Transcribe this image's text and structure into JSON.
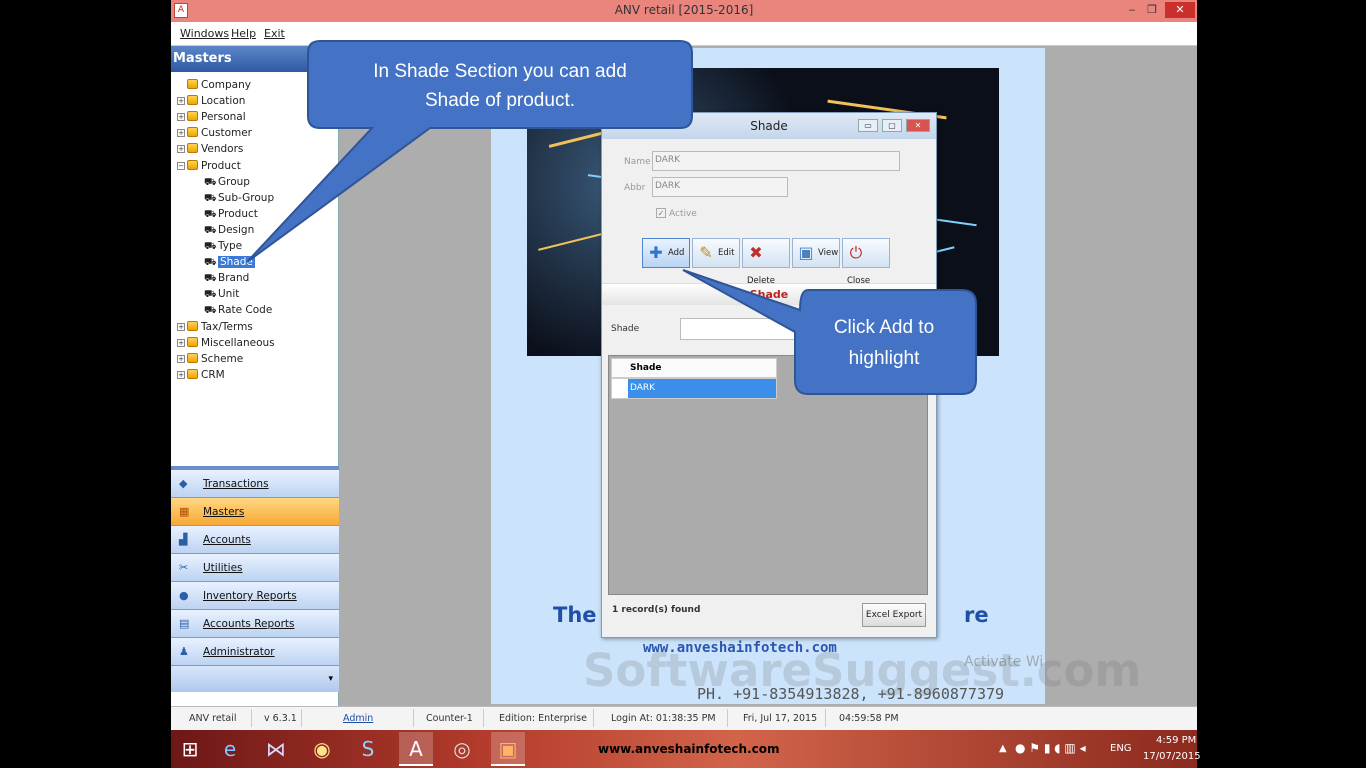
{
  "window": {
    "title": "ANV retail [2015-2016]",
    "icon": "anv-logo-icon",
    "min": "‒",
    "max": "❐",
    "close": "✕"
  },
  "menu": [
    "Windows",
    "Help",
    "Exit"
  ],
  "sidebar": {
    "header": "Masters",
    "tree": [
      {
        "label": "Company",
        "level": 0,
        "expander": ""
      },
      {
        "label": "Location",
        "level": 0,
        "expander": "+"
      },
      {
        "label": "Personal",
        "level": 0,
        "expander": "+"
      },
      {
        "label": "Customer",
        "level": 0,
        "expander": "+"
      },
      {
        "label": "Vendors",
        "level": 0,
        "expander": "+"
      },
      {
        "label": "Product",
        "level": 0,
        "expander": "−"
      },
      {
        "label": "Group",
        "level": 1
      },
      {
        "label": "Sub-Group",
        "level": 1
      },
      {
        "label": "Product",
        "level": 1
      },
      {
        "label": "Design",
        "level": 1
      },
      {
        "label": "Type",
        "level": 1
      },
      {
        "label": "Shade",
        "level": 1,
        "selected": true
      },
      {
        "label": "Brand",
        "level": 1
      },
      {
        "label": "Unit",
        "level": 1
      },
      {
        "label": "Rate Code",
        "level": 1
      },
      {
        "label": "Tax/Terms",
        "level": 0,
        "expander": "+"
      },
      {
        "label": "Miscellaneous",
        "level": 0,
        "expander": "+"
      },
      {
        "label": "Scheme",
        "level": 0,
        "expander": "+"
      },
      {
        "label": "CRM",
        "level": 0,
        "expander": "+"
      }
    ],
    "nav": [
      {
        "label": "Transactions",
        "icon": "transactions-icon",
        "glyph": "◆"
      },
      {
        "label": "Masters",
        "icon": "masters-icon",
        "glyph": "▦",
        "active": true
      },
      {
        "label": "Accounts",
        "icon": "accounts-icon",
        "glyph": "▟"
      },
      {
        "label": "Utilities",
        "icon": "utilities-icon",
        "glyph": "✂"
      },
      {
        "label": "Inventory Reports",
        "icon": "inventory-reports-icon",
        "glyph": "●"
      },
      {
        "label": "Accounts Reports",
        "icon": "accounts-reports-icon",
        "glyph": "▤"
      },
      {
        "label": "Administrator",
        "icon": "administrator-icon",
        "glyph": "♟"
      }
    ],
    "more": "▾"
  },
  "splash": {
    "tagline_left": "The E",
    "tagline_right": "re",
    "website": "www.anveshainfotech.com",
    "phone": "PH. +91-8354913828, +91-8960877379",
    "watermark": "SoftwareSuggest.com",
    "activate": "Activate Wi"
  },
  "dialog": {
    "title": "Shade",
    "name_label": "Name",
    "name_value": "DARK",
    "abbr_label": "Abbr",
    "abbr_value": "DARK",
    "active_label": "Active",
    "active_check": "✓",
    "buttons": [
      {
        "label": "Add",
        "icon": "add-icon",
        "glyph": "✚",
        "color": "#2f74d0"
      },
      {
        "label": "Edit",
        "icon": "edit-icon",
        "glyph": "✎",
        "color": "#c98a12"
      },
      {
        "label": "Delete",
        "icon": "delete-icon",
        "glyph": "✖",
        "color": "#c0302a"
      },
      {
        "label": "View",
        "icon": "view-icon",
        "glyph": "▣",
        "color": "#4a7fc2"
      },
      {
        "label": "Close",
        "icon": "close-icon",
        "glyph": "⏻",
        "color": "#c0302a"
      }
    ],
    "section_title": "Shade",
    "filter_label": "Shade",
    "grid_header": "Shade",
    "grid_rows": [
      "DARK"
    ],
    "record_count": "1 record(s) found",
    "export_label": "Excel Export",
    "win_min": "▭",
    "win_max": "▢",
    "win_close": "✕"
  },
  "callouts": {
    "shade_section": "In Shade Section you can add Shade of product.",
    "shade_line1": "In Shade Section you can add",
    "shade_line2": "Shade of product.",
    "add_line1": "Click Add to",
    "add_line2": "highlight",
    "fill": "#4472c4",
    "stroke": "#2f5597"
  },
  "status": {
    "app": "ANV retail",
    "version": "v 6.3.1",
    "user": "Admin",
    "counter": "Counter-1",
    "edition": "Edition: Enterprise",
    "login": "Login At: 01:38:35 PM",
    "date": "Fri, Jul 17, 2015",
    "time": "04:59:58 PM"
  },
  "taskbar": {
    "site": "www.anveshainfotech.com",
    "lang": "ENG",
    "clock_time": "4:59 PM",
    "clock_date": "17/07/2015",
    "tray_arrow": "▲"
  }
}
